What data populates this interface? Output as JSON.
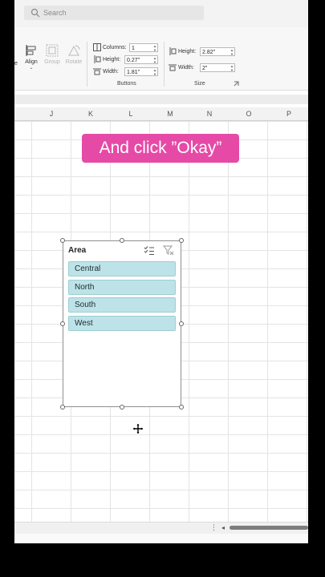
{
  "search": {
    "placeholder": "Search",
    "icon": "search-icon"
  },
  "ribbon": {
    "arrange": {
      "partial_label": "e",
      "align": "Align",
      "group": "Group",
      "rotate": "Rotate"
    },
    "buttons_group": {
      "columns_label": "Columns:",
      "columns_value": "1",
      "height_label": "Height:",
      "height_value": "0.27\"",
      "width_label": "Width:",
      "width_value": "1.81\"",
      "group_label": "Buttons"
    },
    "size_group": {
      "height_label": "Height:",
      "height_value": "2.82\"",
      "width_label": "Width:",
      "width_value": "2\"",
      "group_label": "Size"
    }
  },
  "columns": [
    "J",
    "K",
    "L",
    "M",
    "N",
    "O",
    "P"
  ],
  "callout": {
    "text": "And click ”Okay”",
    "color": "#e64aa7"
  },
  "slicer": {
    "title": "Area",
    "items": [
      "Central",
      "North",
      "South",
      "West"
    ],
    "item_color": "#bde3e8"
  }
}
